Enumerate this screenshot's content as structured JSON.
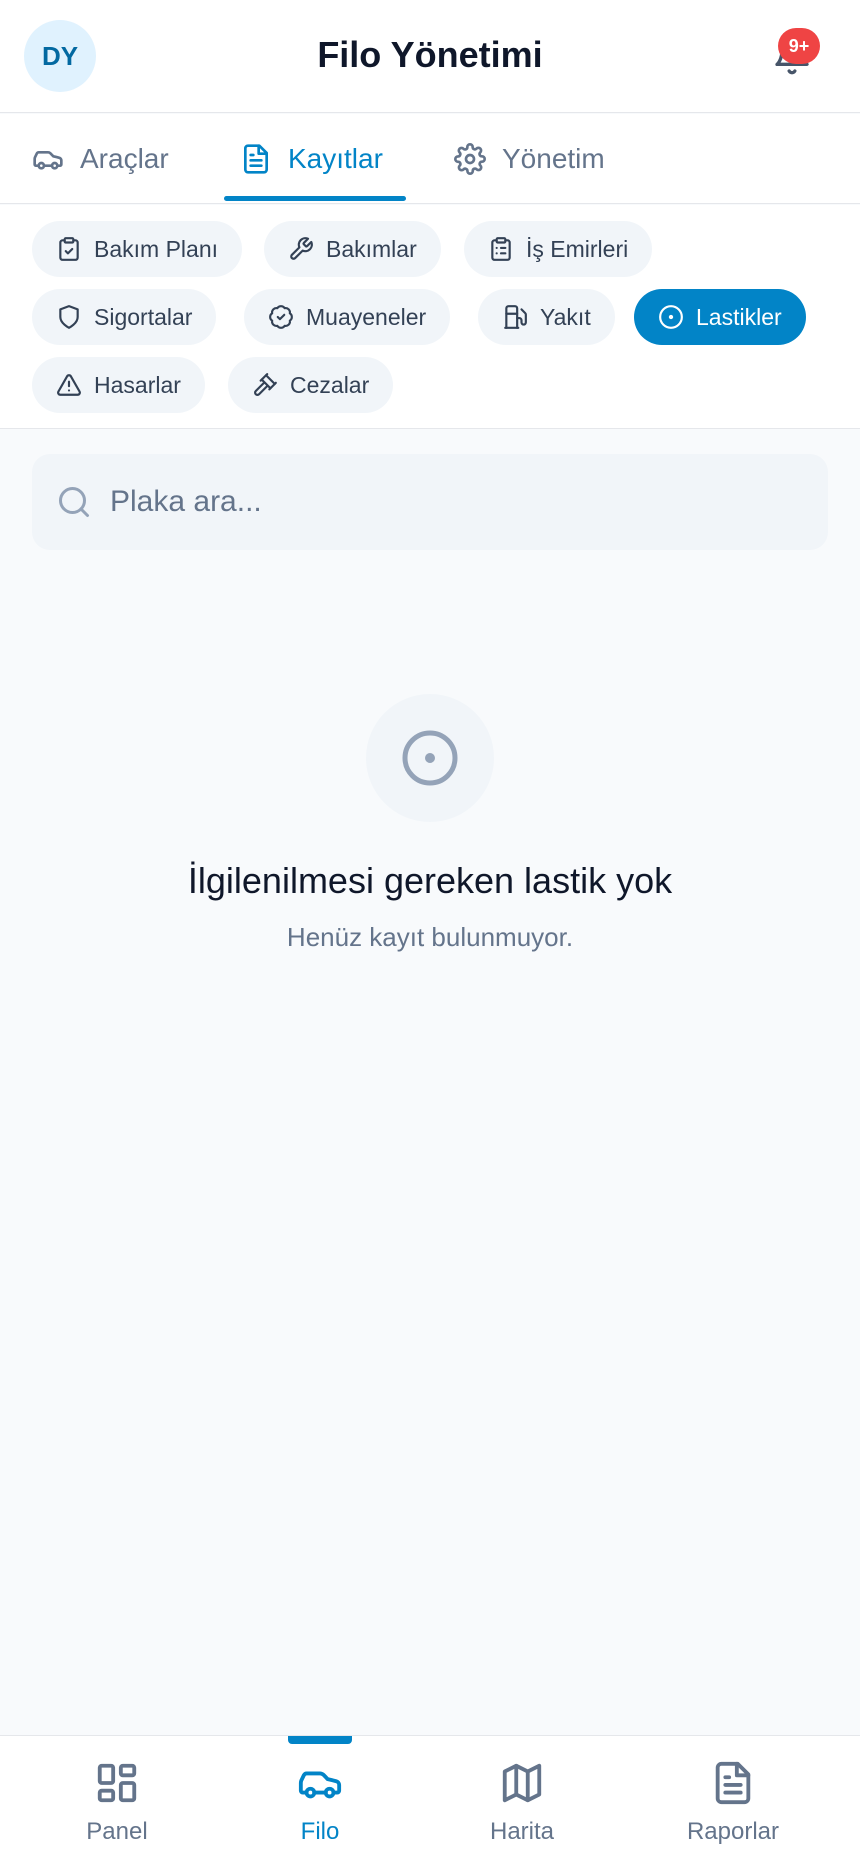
{
  "header": {
    "avatar_initials": "DY",
    "title": "Filo Yönetimi",
    "notification_badge": "9+"
  },
  "tabs": [
    {
      "label": "Araçlar",
      "icon": "car-icon",
      "active": false
    },
    {
      "label": "Kayıtlar",
      "icon": "document-icon",
      "active": true
    },
    {
      "label": "Yönetim",
      "icon": "gear-icon",
      "active": false
    }
  ],
  "chips": [
    {
      "label": "Bakım Planı",
      "icon": "clipboard-check-icon",
      "active": false
    },
    {
      "label": "Bakımlar",
      "icon": "wrench-icon",
      "active": false
    },
    {
      "label": "İş Emirleri",
      "icon": "clipboard-list-icon",
      "active": false
    },
    {
      "label": "Sigortalar",
      "icon": "shield-icon",
      "active": false
    },
    {
      "label": "Muayeneler",
      "icon": "badge-check-icon",
      "active": false
    },
    {
      "label": "Yakıt",
      "icon": "fuel-icon",
      "active": false
    },
    {
      "label": "Lastikler",
      "icon": "tire-icon",
      "active": true
    },
    {
      "label": "Hasarlar",
      "icon": "warning-icon",
      "active": false
    },
    {
      "label": "Cezalar",
      "icon": "gavel-icon",
      "active": false
    }
  ],
  "search": {
    "placeholder": "Plaka ara...",
    "value": ""
  },
  "empty_state": {
    "icon": "tire-icon",
    "title": "İlgilenilmesi gereken lastik yok",
    "subtitle": "Henüz kayıt bulunmuyor."
  },
  "bottom_nav": [
    {
      "label": "Panel",
      "icon": "grid-icon",
      "active": false
    },
    {
      "label": "Filo",
      "icon": "car-icon",
      "active": true
    },
    {
      "label": "Harita",
      "icon": "map-icon",
      "active": false
    },
    {
      "label": "Raporlar",
      "icon": "report-icon",
      "active": false
    }
  ],
  "colors": {
    "accent": "#0284c7",
    "badge": "#ef4444",
    "chip_bg": "#f1f5f9",
    "avatar_bg": "#e0f2fe",
    "muted_text": "#64748b"
  }
}
